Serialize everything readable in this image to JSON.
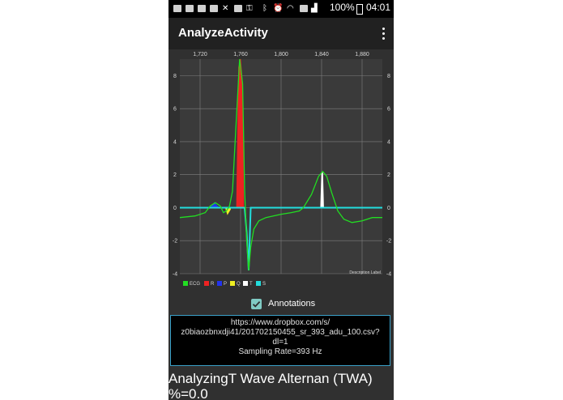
{
  "status_bar": {
    "battery": "100%",
    "time": "04:01"
  },
  "app_bar": {
    "title": "AnalyzeActivity",
    "menu_icon": "overflow-menu-icon"
  },
  "chart": {
    "x_ticks": [
      "1,720",
      "1,760",
      "1,800",
      "1,840",
      "1,880"
    ],
    "y_ticks": [
      "8",
      "6",
      "4",
      "2",
      "0",
      "-2",
      "-4"
    ],
    "corner_text": "Description Label",
    "legend": [
      {
        "label": "ECG",
        "color": "#22dd22"
      },
      {
        "label": "R",
        "color": "#ee2222"
      },
      {
        "label": "P",
        "color": "#2233ee"
      },
      {
        "label": "Q",
        "color": "#eeee22"
      },
      {
        "label": "T",
        "color": "#ffffff"
      },
      {
        "label": "S",
        "color": "#22dddd"
      }
    ]
  },
  "chart_data": {
    "type": "line",
    "x_range": [
      1700,
      1900
    ],
    "y_range": [
      -4,
      9
    ],
    "grid": true,
    "legend_placement": "bottom-left",
    "series": [
      {
        "name": "ECG",
        "color": "#22dd22",
        "points": [
          [
            1700,
            -0.6
          ],
          [
            1715,
            -0.5
          ],
          [
            1725,
            -0.3
          ],
          [
            1730,
            0.1
          ],
          [
            1735,
            0.3
          ],
          [
            1740,
            0.1
          ],
          [
            1743,
            -0.3
          ],
          [
            1746,
            -0.2
          ],
          [
            1749,
            0.1
          ],
          [
            1752,
            1.0
          ],
          [
            1755,
            4.5
          ],
          [
            1759,
            9.0
          ],
          [
            1762,
            7.5
          ],
          [
            1764,
            1.0
          ],
          [
            1766,
            -2.0
          ],
          [
            1768,
            -3.8
          ],
          [
            1770,
            -2.4
          ],
          [
            1773,
            -1.3
          ],
          [
            1778,
            -0.8
          ],
          [
            1785,
            -0.6
          ],
          [
            1800,
            -0.4
          ],
          [
            1810,
            -0.3
          ],
          [
            1818,
            -0.2
          ],
          [
            1822,
            0.0
          ],
          [
            1830,
            0.8
          ],
          [
            1837,
            1.9
          ],
          [
            1841,
            2.2
          ],
          [
            1845,
            1.9
          ],
          [
            1850,
            0.9
          ],
          [
            1856,
            -0.2
          ],
          [
            1862,
            -0.7
          ],
          [
            1870,
            -0.9
          ],
          [
            1880,
            -0.8
          ],
          [
            1890,
            -0.6
          ],
          [
            1900,
            -0.6
          ]
        ]
      },
      {
        "name": "R",
        "color": "#ee2222",
        "points": [
          [
            1756,
            0
          ],
          [
            1758,
            8.5
          ],
          [
            1760,
            9.0
          ],
          [
            1762,
            7.5
          ],
          [
            1763,
            0
          ]
        ]
      },
      {
        "name": "P",
        "color": "#2233ee",
        "points": [
          [
            1730,
            0
          ],
          [
            1734,
            0.3
          ],
          [
            1737,
            0.1
          ],
          [
            1739,
            0
          ]
        ]
      },
      {
        "name": "Q",
        "color": "#eeee22",
        "points": [
          [
            1745,
            0
          ],
          [
            1747,
            -0.4
          ],
          [
            1750,
            -0.1
          ]
        ]
      },
      {
        "name": "T",
        "color": "#ffffff",
        "points": [
          [
            1839,
            0
          ],
          [
            1840,
            2.0
          ],
          [
            1841,
            2.2
          ],
          [
            1842,
            0
          ]
        ]
      },
      {
        "name": "S",
        "color": "#22dddd",
        "points": [
          [
            1700,
            0
          ],
          [
            1764,
            0
          ],
          [
            1766,
            -1.5
          ],
          [
            1768,
            -3.8
          ],
          [
            1770,
            0
          ],
          [
            1900,
            0
          ]
        ]
      }
    ]
  },
  "annotations": {
    "label": "Annotations",
    "checked": true
  },
  "info": {
    "line1": "https://www.dropbox.com/s/",
    "line2": "z0biaozbnxdji41/201702150455_sr_393_adu_100.csv?",
    "line3": "dl=1",
    "line4": "Sampling Rate=393 Hz"
  },
  "analysis": {
    "line1": "AnalyzingT Wave Alternan (TWA)",
    "line2": "%=0.0"
  }
}
